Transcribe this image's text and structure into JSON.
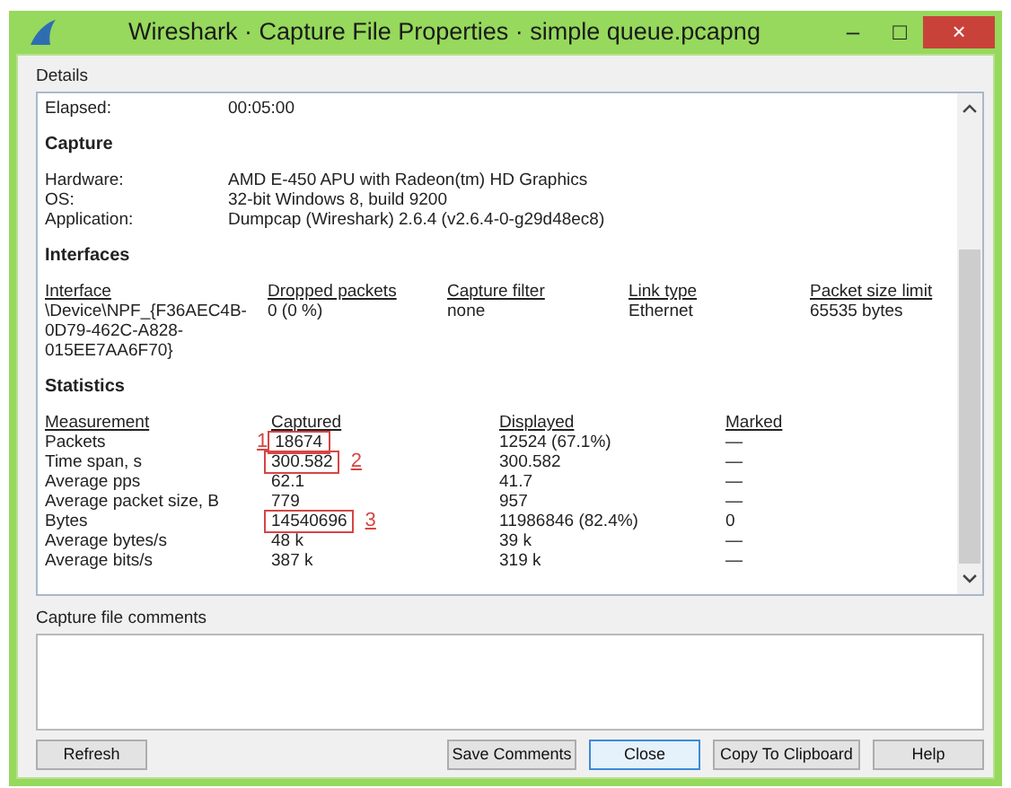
{
  "window": {
    "title": "Wireshark · Capture File Properties · simple queue.pcapng",
    "controls": [
      "–",
      "□",
      "×"
    ]
  },
  "details": {
    "label": "Details",
    "sections": [
      {
        "kind": "pairs",
        "rows": [
          {
            "label": "Elapsed:",
            "value": "00:05:00"
          }
        ]
      },
      {
        "kind": "pairs",
        "heading": "Capture",
        "rows": [
          {
            "label": "Hardware:",
            "value": "AMD E-450 APU with Radeon(tm) HD Graphics"
          },
          {
            "label": "OS:",
            "value": "32-bit Windows 8, build 9200"
          },
          {
            "label": "Application:",
            "value": "Dumpcap (Wireshark) 2.6.4 (v2.6.4-0-g29d48ec8)"
          }
        ]
      },
      {
        "kind": "table",
        "heading": "Interfaces",
        "columns": [
          "Interface",
          "Dropped packets",
          "Capture filter",
          "Link type",
          "Packet size limit"
        ],
        "rows": [
          {
            "cells": [
              "\\Device\\NPF_{F36AEC4B-0D79-462C-A828-015EE7AA6F70}",
              "0 (0 %)",
              "none",
              "Ethernet",
              "65535 bytes"
            ]
          }
        ]
      },
      {
        "kind": "table",
        "heading": "Statistics",
        "columns": [
          "Measurement",
          "Captured",
          "Displayed",
          "Marked"
        ],
        "rows": [
          {
            "cells": [
              "Packets",
              "18674",
              "12524 (67.1%)",
              "—"
            ],
            "kind": "callout-left",
            "callout": "1"
          },
          {
            "cells": [
              "Time span, s",
              "300.582",
              "300.582",
              "—"
            ],
            "kind": "callout-right",
            "callout": "2"
          },
          {
            "cells": [
              "Average pps",
              "62.1",
              "41.7",
              "—"
            ]
          },
          {
            "cells": [
              "Average packet size, B",
              "779",
              "957",
              "—"
            ]
          },
          {
            "cells": [
              "Bytes",
              "14540696",
              "11986846 (82.4%)",
              "0"
            ],
            "kind": "callout-right",
            "callout": "3"
          },
          {
            "cells": [
              "Average bytes/s",
              "48 k",
              "39 k",
              "—"
            ]
          },
          {
            "cells": [
              "Average bits/s",
              "387 k",
              "319 k",
              "—"
            ]
          }
        ]
      }
    ]
  },
  "comments": {
    "label": "Capture file comments"
  },
  "buttons": [
    {
      "label": "Refresh",
      "focused": false
    },
    {
      "label": "Save Comments",
      "focused": false
    },
    {
      "label": "Close",
      "focused": true
    },
    {
      "label": "Copy To Clipboard",
      "focused": false
    },
    {
      "label": "Help",
      "focused": false
    }
  ]
}
